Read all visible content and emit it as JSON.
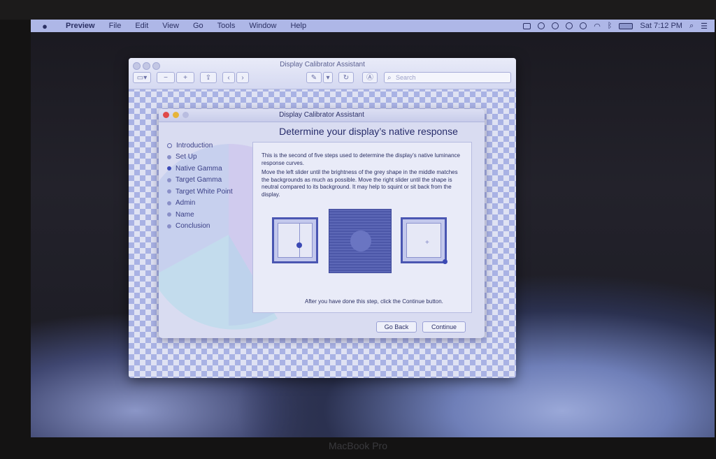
{
  "menubar": {
    "app_name": "Preview",
    "items": [
      "File",
      "Edit",
      "View",
      "Go",
      "Tools",
      "Window",
      "Help"
    ],
    "clock": "Sat 7:12 PM"
  },
  "preview_window": {
    "title": "Display Calibrator Assistant",
    "search_placeholder": "Search"
  },
  "calibrator": {
    "title": "Display Calibrator Assistant",
    "heading": "Determine your display’s native response",
    "steps": [
      {
        "label": "Introduction",
        "state": "done"
      },
      {
        "label": "Set Up",
        "state": "pending"
      },
      {
        "label": "Native Gamma",
        "state": "active"
      },
      {
        "label": "Target Gamma",
        "state": "pending"
      },
      {
        "label": "Target White Point",
        "state": "pending"
      },
      {
        "label": "Admin",
        "state": "pending"
      },
      {
        "label": "Name",
        "state": "pending"
      },
      {
        "label": "Conclusion",
        "state": "pending"
      }
    ],
    "paragraph_1": "This is the second of five steps used to determine the display’s native luminance response curves.",
    "paragraph_2": "Move the left slider until the brightness of the grey shape in the middle matches the backgrounds as much as possible.  Move the right slider until the shape is neutral compared to its background.  It may help to squint or sit back from the display.",
    "footer_note": "After you have done this step, click the Continue button.",
    "go_back_label": "Go Back",
    "continue_label": "Continue"
  },
  "device_brand": "MacBook Pro",
  "colors": {
    "menubar": "#aeb7e7",
    "accent": "#3d4bb7",
    "window_bg": "#d9dcf1"
  }
}
